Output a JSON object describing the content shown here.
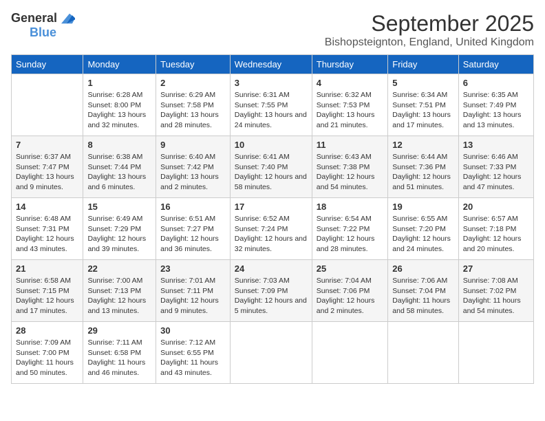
{
  "header": {
    "logo_general": "General",
    "logo_blue": "Blue",
    "month": "September 2025",
    "location": "Bishopsteignton, England, United Kingdom"
  },
  "columns": [
    "Sunday",
    "Monday",
    "Tuesday",
    "Wednesday",
    "Thursday",
    "Friday",
    "Saturday"
  ],
  "weeks": [
    [
      {
        "day": "",
        "sunrise": "",
        "sunset": "",
        "daylight": ""
      },
      {
        "day": "1",
        "sunrise": "Sunrise: 6:28 AM",
        "sunset": "Sunset: 8:00 PM",
        "daylight": "Daylight: 13 hours and 32 minutes."
      },
      {
        "day": "2",
        "sunrise": "Sunrise: 6:29 AM",
        "sunset": "Sunset: 7:58 PM",
        "daylight": "Daylight: 13 hours and 28 minutes."
      },
      {
        "day": "3",
        "sunrise": "Sunrise: 6:31 AM",
        "sunset": "Sunset: 7:55 PM",
        "daylight": "Daylight: 13 hours and 24 minutes."
      },
      {
        "day": "4",
        "sunrise": "Sunrise: 6:32 AM",
        "sunset": "Sunset: 7:53 PM",
        "daylight": "Daylight: 13 hours and 21 minutes."
      },
      {
        "day": "5",
        "sunrise": "Sunrise: 6:34 AM",
        "sunset": "Sunset: 7:51 PM",
        "daylight": "Daylight: 13 hours and 17 minutes."
      },
      {
        "day": "6",
        "sunrise": "Sunrise: 6:35 AM",
        "sunset": "Sunset: 7:49 PM",
        "daylight": "Daylight: 13 hours and 13 minutes."
      }
    ],
    [
      {
        "day": "7",
        "sunrise": "Sunrise: 6:37 AM",
        "sunset": "Sunset: 7:47 PM",
        "daylight": "Daylight: 13 hours and 9 minutes."
      },
      {
        "day": "8",
        "sunrise": "Sunrise: 6:38 AM",
        "sunset": "Sunset: 7:44 PM",
        "daylight": "Daylight: 13 hours and 6 minutes."
      },
      {
        "day": "9",
        "sunrise": "Sunrise: 6:40 AM",
        "sunset": "Sunset: 7:42 PM",
        "daylight": "Daylight: 13 hours and 2 minutes."
      },
      {
        "day": "10",
        "sunrise": "Sunrise: 6:41 AM",
        "sunset": "Sunset: 7:40 PM",
        "daylight": "Daylight: 12 hours and 58 minutes."
      },
      {
        "day": "11",
        "sunrise": "Sunrise: 6:43 AM",
        "sunset": "Sunset: 7:38 PM",
        "daylight": "Daylight: 12 hours and 54 minutes."
      },
      {
        "day": "12",
        "sunrise": "Sunrise: 6:44 AM",
        "sunset": "Sunset: 7:36 PM",
        "daylight": "Daylight: 12 hours and 51 minutes."
      },
      {
        "day": "13",
        "sunrise": "Sunrise: 6:46 AM",
        "sunset": "Sunset: 7:33 PM",
        "daylight": "Daylight: 12 hours and 47 minutes."
      }
    ],
    [
      {
        "day": "14",
        "sunrise": "Sunrise: 6:48 AM",
        "sunset": "Sunset: 7:31 PM",
        "daylight": "Daylight: 12 hours and 43 minutes."
      },
      {
        "day": "15",
        "sunrise": "Sunrise: 6:49 AM",
        "sunset": "Sunset: 7:29 PM",
        "daylight": "Daylight: 12 hours and 39 minutes."
      },
      {
        "day": "16",
        "sunrise": "Sunrise: 6:51 AM",
        "sunset": "Sunset: 7:27 PM",
        "daylight": "Daylight: 12 hours and 36 minutes."
      },
      {
        "day": "17",
        "sunrise": "Sunrise: 6:52 AM",
        "sunset": "Sunset: 7:24 PM",
        "daylight": "Daylight: 12 hours and 32 minutes."
      },
      {
        "day": "18",
        "sunrise": "Sunrise: 6:54 AM",
        "sunset": "Sunset: 7:22 PM",
        "daylight": "Daylight: 12 hours and 28 minutes."
      },
      {
        "day": "19",
        "sunrise": "Sunrise: 6:55 AM",
        "sunset": "Sunset: 7:20 PM",
        "daylight": "Daylight: 12 hours and 24 minutes."
      },
      {
        "day": "20",
        "sunrise": "Sunrise: 6:57 AM",
        "sunset": "Sunset: 7:18 PM",
        "daylight": "Daylight: 12 hours and 20 minutes."
      }
    ],
    [
      {
        "day": "21",
        "sunrise": "Sunrise: 6:58 AM",
        "sunset": "Sunset: 7:15 PM",
        "daylight": "Daylight: 12 hours and 17 minutes."
      },
      {
        "day": "22",
        "sunrise": "Sunrise: 7:00 AM",
        "sunset": "Sunset: 7:13 PM",
        "daylight": "Daylight: 12 hours and 13 minutes."
      },
      {
        "day": "23",
        "sunrise": "Sunrise: 7:01 AM",
        "sunset": "Sunset: 7:11 PM",
        "daylight": "Daylight: 12 hours and 9 minutes."
      },
      {
        "day": "24",
        "sunrise": "Sunrise: 7:03 AM",
        "sunset": "Sunset: 7:09 PM",
        "daylight": "Daylight: 12 hours and 5 minutes."
      },
      {
        "day": "25",
        "sunrise": "Sunrise: 7:04 AM",
        "sunset": "Sunset: 7:06 PM",
        "daylight": "Daylight: 12 hours and 2 minutes."
      },
      {
        "day": "26",
        "sunrise": "Sunrise: 7:06 AM",
        "sunset": "Sunset: 7:04 PM",
        "daylight": "Daylight: 11 hours and 58 minutes."
      },
      {
        "day": "27",
        "sunrise": "Sunrise: 7:08 AM",
        "sunset": "Sunset: 7:02 PM",
        "daylight": "Daylight: 11 hours and 54 minutes."
      }
    ],
    [
      {
        "day": "28",
        "sunrise": "Sunrise: 7:09 AM",
        "sunset": "Sunset: 7:00 PM",
        "daylight": "Daylight: 11 hours and 50 minutes."
      },
      {
        "day": "29",
        "sunrise": "Sunrise: 7:11 AM",
        "sunset": "Sunset: 6:58 PM",
        "daylight": "Daylight: 11 hours and 46 minutes."
      },
      {
        "day": "30",
        "sunrise": "Sunrise: 7:12 AM",
        "sunset": "Sunset: 6:55 PM",
        "daylight": "Daylight: 11 hours and 43 minutes."
      },
      {
        "day": "",
        "sunrise": "",
        "sunset": "",
        "daylight": ""
      },
      {
        "day": "",
        "sunrise": "",
        "sunset": "",
        "daylight": ""
      },
      {
        "day": "",
        "sunrise": "",
        "sunset": "",
        "daylight": ""
      },
      {
        "day": "",
        "sunrise": "",
        "sunset": "",
        "daylight": ""
      }
    ]
  ]
}
